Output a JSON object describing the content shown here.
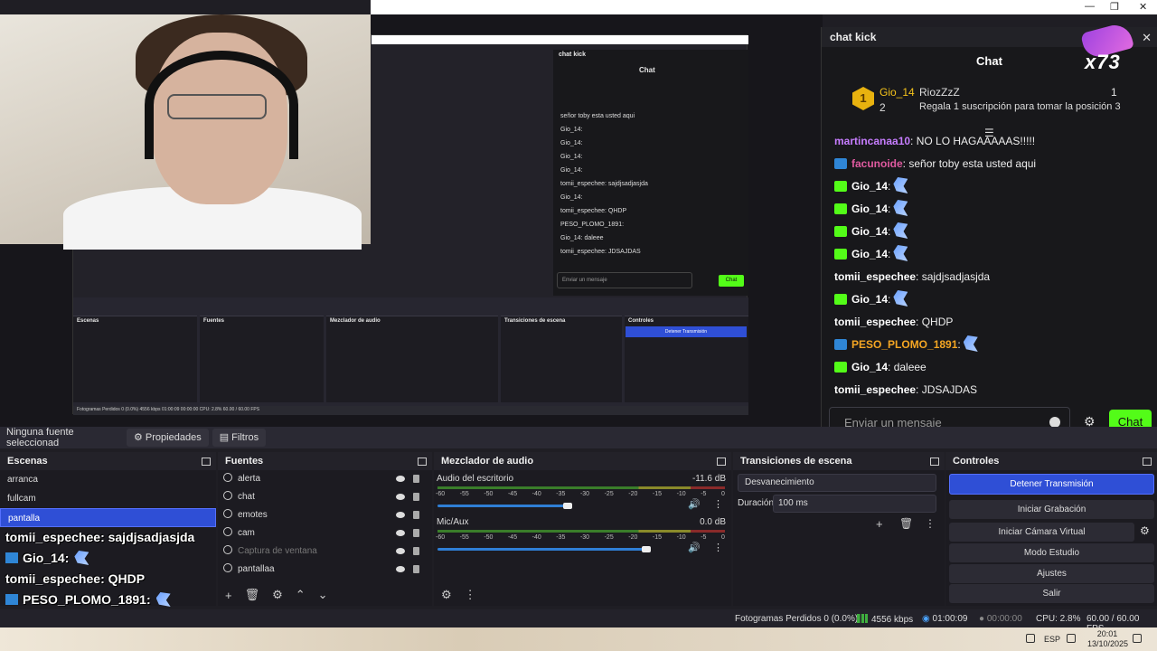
{
  "window": {
    "restore_label": "❐",
    "minimize_label": "—",
    "close_label": "✕"
  },
  "chat": {
    "window_title": "chat kick",
    "close_label": "✕",
    "title": "Chat",
    "sub_badge": "x73",
    "leader": {
      "rank": "1",
      "user": "Gio_14",
      "count": "2",
      "gifter": "RiozZzZ",
      "gift_count": "1",
      "gift_text": "Regala 1 suscripción para tomar la posición 3"
    },
    "messages": [
      {
        "user": "martincanaa10",
        "text": ": NO LO HAGAAAAAS!!!!!",
        "color": "#c77dff",
        "icon": ""
      },
      {
        "user": "facunoide",
        "text": ": señor toby esta usted aqui",
        "color": "#e05aa0",
        "icon": "#2f86d6"
      },
      {
        "user": "Gio_14",
        "text": ":",
        "color": "#ffffff",
        "icon": "#53fc18",
        "emote": true
      },
      {
        "user": "Gio_14",
        "text": ":",
        "color": "#ffffff",
        "icon": "#53fc18",
        "emote": true
      },
      {
        "user": "Gio_14",
        "text": ":",
        "color": "#ffffff",
        "icon": "#53fc18",
        "emote": true
      },
      {
        "user": "Gio_14",
        "text": ":",
        "color": "#ffffff",
        "icon": "#53fc18",
        "emote": true
      },
      {
        "user": "tomii_espechee",
        "text": ": sajdjsadjasjda",
        "color": "#ffffff",
        "icon": ""
      },
      {
        "user": "Gio_14",
        "text": ":",
        "color": "#ffffff",
        "icon": "#53fc18",
        "emote": true
      },
      {
        "user": "tomii_espechee",
        "text": ": QHDP",
        "color": "#ffffff",
        "icon": ""
      },
      {
        "user": "PESO_PLOMO_1891",
        "text": ":",
        "color": "#f5a623",
        "icon": "#2f86d6",
        "emote": true
      },
      {
        "user": "Gio_14",
        "text": ": daleee",
        "color": "#ffffff",
        "icon": "#53fc18"
      },
      {
        "user": "tomii_espechee",
        "text": ": JDSAJDAS",
        "color": "#ffffff",
        "icon": ""
      }
    ],
    "input_placeholder": "Enviar un mensaje",
    "send_label": "Chat"
  },
  "source_bar": {
    "no_source": "Ninguna fuente seleccionad",
    "properties": "Propiedades",
    "filters": "Filtros"
  },
  "scenes": {
    "title": "Escenas",
    "items": [
      "arranca",
      "fullcam",
      "pantalla"
    ],
    "active": 2
  },
  "sources": {
    "title": "Fuentes",
    "items": [
      "alerta",
      "chat",
      "emotes",
      "cam",
      "Captura de ventana",
      "pantallaa"
    ]
  },
  "mixer": {
    "title": "Mezclador de audio",
    "channels": [
      {
        "name": "Audio del escritorio",
        "db": "-11.6 dB",
        "volume": 0.53
      },
      {
        "name": "Mic/Aux",
        "db": "0.0 dB",
        "volume": 0.85
      }
    ],
    "ticks": [
      "-60",
      "-55",
      "-50",
      "-45",
      "-40",
      "-35",
      "-30",
      "-25",
      "-20",
      "-15",
      "-10",
      "-5",
      "0"
    ]
  },
  "transitions": {
    "title": "Transiciones de escena",
    "type": "Desvanecimiento",
    "duration_label": "Duración",
    "duration": "100 ms"
  },
  "controls": {
    "title": "Controles",
    "buttons": [
      "Detener Transmisión",
      "Iniciar Grabación",
      "Iniciar Cámara Virtual",
      "Modo Estudio",
      "Ajustes",
      "Salir"
    ]
  },
  "overlay": [
    {
      "user": "tomii_espechee",
      "text": ": sajdjsadjasjda",
      "icon": false,
      "emote": false
    },
    {
      "user": "Gio_14",
      "text": ":",
      "icon": true,
      "emote": true
    },
    {
      "user": "tomii_espechee",
      "text": ": QHDP",
      "icon": false,
      "emote": false
    },
    {
      "user": "PESO_PLOMO_1891",
      "text": ":",
      "icon": true,
      "emote": true
    },
    {
      "user": "Gio_14",
      "text": ": daleee",
      "icon": true,
      "emote": false
    },
    {
      "user": "tomii_espechee",
      "text": ": JDSAJDAS",
      "icon": false,
      "emote": false
    }
  ],
  "status": {
    "dropped": "Fotogramas Perdidos 0 (0.0%)",
    "kbps": "4556 kbps",
    "stream_time": "01:00:09",
    "rec_time": "00:00:00",
    "cpu": "CPU: 2.8%",
    "fps": "60.00 / 60.00 FPS"
  },
  "taskbar": {
    "lang": "ESP",
    "time": "20:01",
    "date": "13/10/2025"
  },
  "nested": {
    "chat_title": "chat kick",
    "chat_header": "Chat",
    "lines": [
      "señor toby esta usted aqui",
      "Gio_14:",
      "Gio_14:",
      "Gio_14:",
      "Gio_14:",
      "tomii_espechee: sajdjsadjasjda",
      "Gio_14:",
      "tomii_espechee: QHDP",
      "PESO_PLOMO_1891:",
      "Gio_14: daleee",
      "tomii_espechee: JDSAJDAS"
    ],
    "input": "Enviar un mensaje",
    "send": "Chat",
    "panels": [
      "Escenas",
      "Fuentes",
      "Mezclador de audio",
      "Transiciones de escena",
      "Controles"
    ],
    "stream_btn": "Detener Transmisión",
    "status": "Fotogramas Perdidos 0 (0.0%)   4556 kbps   01:00:09   00:00:00   CPU: 2.8%   60.00 / 60.00 FPS"
  }
}
